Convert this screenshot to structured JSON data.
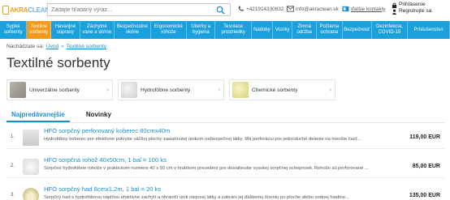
{
  "header": {
    "logo_part1": "AKRA",
    "logo_part2": "CLEAN",
    "search_placeholder": "Zadajte hľadaný výraz...",
    "phone": "+421914330832",
    "email": "info@akraclean.sk",
    "more_contacts": "ďalšie kontakty",
    "login": "Prihlásenie",
    "register": "Registrujte sa"
  },
  "nav": {
    "items": [
      {
        "label": "Sypké\nsorbenty",
        "active": false
      },
      {
        "label": "Textilné\nsorbenty",
        "active": true
      },
      {
        "label": "Havarijné\nsúpravy",
        "active": false
      },
      {
        "label": "Záchytné\nvane a skrine",
        "active": false
      },
      {
        "label": "Bezpečnostné\nskrine",
        "active": false
      },
      {
        "label": "Ergonomické\nrohože",
        "active": false
      },
      {
        "label": "Utierky a\nhygiena",
        "active": false
      },
      {
        "label": "Tesniace\nprostriedky",
        "active": false
      },
      {
        "label": "Nádoby",
        "active": false
      },
      {
        "label": "Vozíky",
        "active": false
      },
      {
        "label": "Zimná\núdržba",
        "active": false
      },
      {
        "label": "Požiarna\nochrana",
        "active": false
      },
      {
        "label": "Bezpečnosť",
        "active": false
      },
      {
        "label": "Dezinfekcia,\nCOVID-19",
        "active": false
      },
      {
        "label": "Príslušenstvo",
        "active": false
      }
    ]
  },
  "breadcrumb": {
    "prefix": "Nachádzate sa:",
    "home": "Úvod",
    "separator": "»",
    "current": "Textilné sorbenty"
  },
  "page": {
    "title": "Textilné sorbenty"
  },
  "categories": [
    {
      "label": "Univerzálne sorbenty"
    },
    {
      "label": "Hydrofóbne sorbenty"
    },
    {
      "label": "Chemické sorbenty"
    }
  ],
  "tabs": [
    {
      "label": "Najpredávanejšie",
      "active": true
    },
    {
      "label": "Novinky",
      "active": false
    }
  ],
  "products": [
    {
      "num": "1.",
      "title": "HFO sorpčný perforovaný koberec 80cmx40m",
      "desc": "Hydrofóbny koberec pre efektívne pokrytie väčšej plochy zasiahnutej únikom nebezpečnej látky. Má perforáciu pre jednoduché delenie na menšie časť...",
      "price": "119,00 EUR"
    },
    {
      "num": "2.",
      "title": "HFO sorpčná rohož 40x50cm, 1 bal = 100 ks",
      "desc": "Sorpčné hydrofóbne rohože v praktickom rozmere 40 x 50 cm v hrubšom prevedení pre dosiahnutie vysokej sorpčnej schopnosti. Rohože sú perforované ...",
      "price": "85,00 EUR"
    },
    {
      "num": "3.",
      "title": "HFO sorpčný had 8cmx1,2m, 1 bal = 20 ks",
      "desc": "Sorpčný had s hydrofóbnou náplňou efektívne zachytí a ohraničí únik olejovej látky a zabráni jej ďalšiemu šíreniu po ploche alebo vodnej hladine...",
      "price": "135,00 EUR"
    }
  ]
}
